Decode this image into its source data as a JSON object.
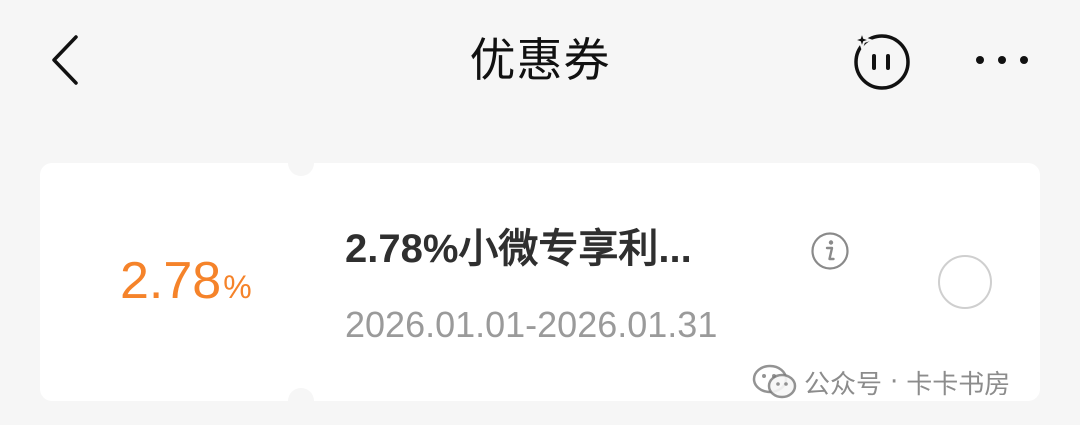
{
  "header": {
    "title": "优惠券"
  },
  "coupon": {
    "rate_value": "2.78",
    "rate_unit": "%",
    "name": "2.78%小微专享利...",
    "date_range": "2026.01.01-2026.01.31",
    "accent_color": "#f5832a"
  },
  "watermark": {
    "label": "公众号",
    "separator": "·",
    "account": "卡卡书房"
  },
  "icons": {
    "back": "chevron-left-icon",
    "face": "smiley-face-icon",
    "more": "more-dots-icon",
    "info": "info-icon",
    "radio": "radio-unchecked",
    "wechat": "wechat-icon"
  }
}
